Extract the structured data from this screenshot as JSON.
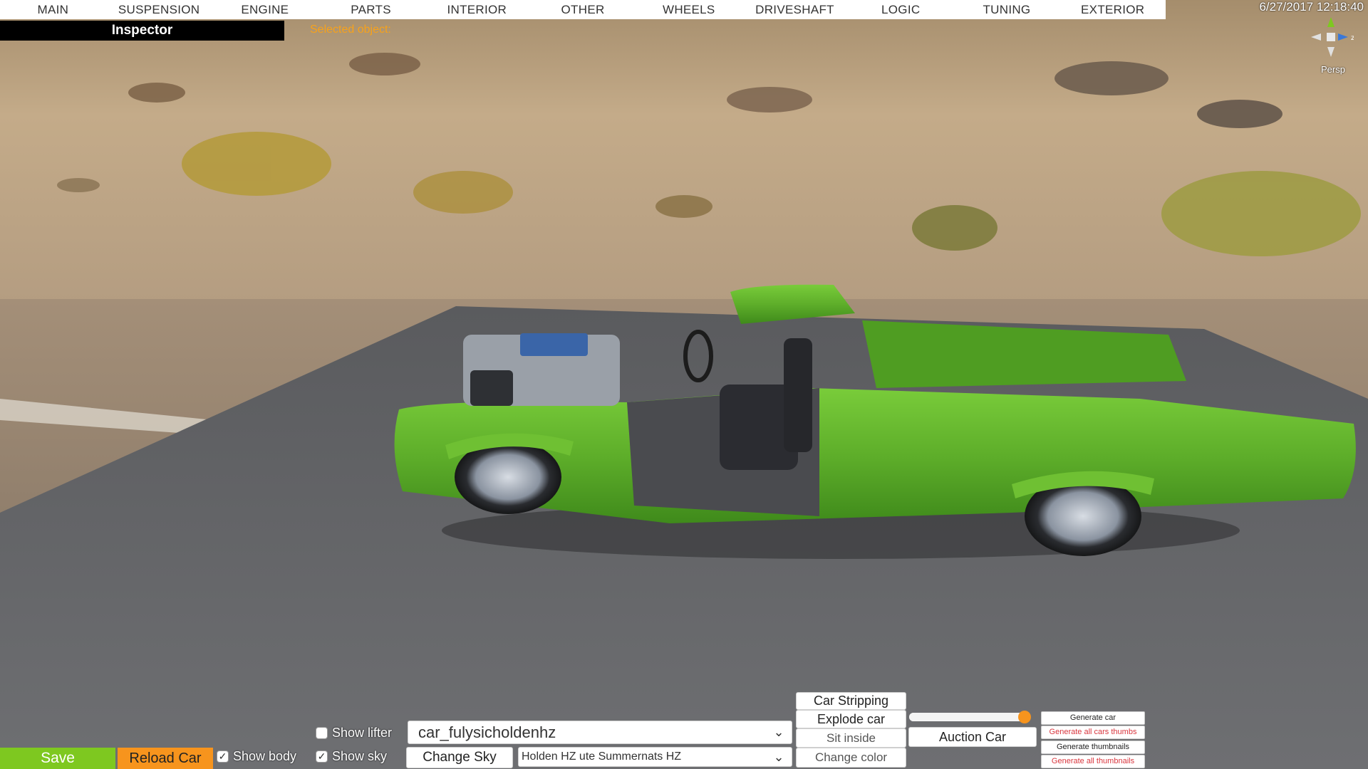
{
  "menu": {
    "items": [
      "MAIN",
      "SUSPENSION",
      "ENGINE",
      "PARTS",
      "INTERIOR",
      "OTHER",
      "WHEELS",
      "DRIVESHAFT",
      "LOGIC",
      "TUNING",
      "EXTERIOR"
    ]
  },
  "header": {
    "datetime": "6/27/2017 12:18:40",
    "inspector": "Inspector",
    "selected_object": "Selected object:",
    "camera_mode": "Persp",
    "gizmo_axis": "z"
  },
  "bottom": {
    "save_label": "Save",
    "reload_label": "Reload Car",
    "show_body_label": "Show body",
    "show_body_checked": true,
    "show_lifter_label": "Show lifter",
    "show_lifter_checked": false,
    "show_sky_label": "Show sky",
    "show_sky_checked": true,
    "car_select_value": "car_fulysicholdenhz",
    "change_sky_label": "Change Sky",
    "sky_select_value": "Holden HZ ute Summernats HZ",
    "car_stripping_label": "Car Stripping",
    "explode_car_label": "Explode car",
    "sit_inside_label": "Sit inside",
    "change_color_label": "Change color",
    "auction_car_label": "Auction Car",
    "slider_level": 0.95,
    "generate_car_label": "Generate car",
    "generate_all_thumbs_label": "Generate all cars thumbs",
    "generate_thumbnails_label": "Generate thumbnails",
    "generate_all_thumbnails_label": "Generate all thumbnails"
  },
  "colors": {
    "accent_orange": "#f7941d",
    "save_green": "#7ec820",
    "car_green": "#5cae28",
    "red_text": "#d9363e"
  },
  "icons": {
    "gizmo": "axis-gizmo-icon",
    "checkbox": "checkbox-icon",
    "dropdown": "chevron-down-icon"
  }
}
